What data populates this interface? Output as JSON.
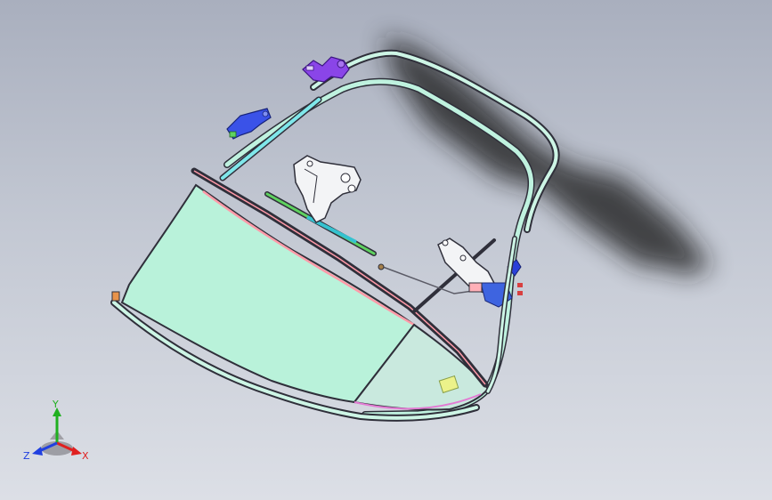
{
  "viewport": {
    "background_top": "#a9afbe",
    "background_bottom": "#dcdfe6"
  },
  "model": {
    "glass_color": "#b9f2da",
    "glass_small_color": "#c9e9de",
    "frame_color": "#bff2df",
    "dark_frame_color": "#2f2f3a",
    "accent_pink": "#ff9aa8",
    "accent_green": "#5fd25f",
    "accent_blue": "#2a40d8",
    "accent_purple": "#7a35d8"
  },
  "triad": {
    "x_label": "X",
    "y_label": "Y",
    "z_label": "Z",
    "x_color": "#e02020",
    "y_color": "#20b020",
    "z_color": "#2040e0"
  }
}
